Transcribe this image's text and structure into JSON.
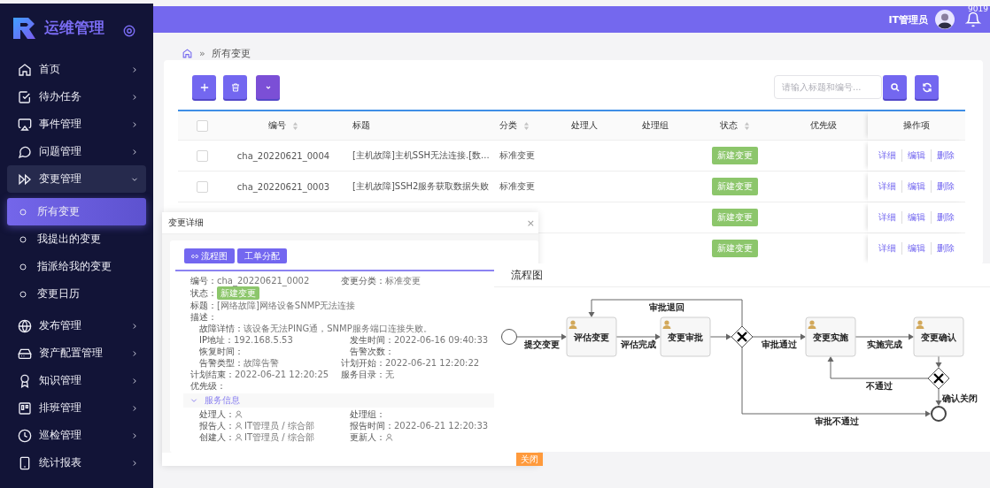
{
  "sidebar": {
    "brand": "运维管理",
    "items": [
      {
        "label": "首页",
        "expanded": false
      },
      {
        "label": "待办任务",
        "expanded": false
      },
      {
        "label": "事件管理",
        "expanded": false
      },
      {
        "label": "问题管理",
        "expanded": false
      },
      {
        "label": "变更管理",
        "expanded": true,
        "children": [
          {
            "label": "所有变更",
            "selected": true
          },
          {
            "label": "我提出的变更",
            "selected": false
          },
          {
            "label": "指派给我的变更",
            "selected": false
          },
          {
            "label": "变更日历",
            "selected": false
          }
        ]
      },
      {
        "label": "发布管理",
        "expanded": false
      },
      {
        "label": "资产配置管理",
        "expanded": false
      },
      {
        "label": "知识管理",
        "expanded": false
      },
      {
        "label": "排班管理",
        "expanded": false
      },
      {
        "label": "巡检管理",
        "expanded": false
      },
      {
        "label": "统计报表",
        "expanded": false
      }
    ]
  },
  "header": {
    "user": "IT管理员",
    "notification_count": "9019"
  },
  "breadcrumb": {
    "separator": "»",
    "current": "所有变更"
  },
  "toolbar": {
    "search": {
      "placeholder": "请输入标题和编号..."
    }
  },
  "table": {
    "columns": [
      {
        "kind": "checkbox",
        "checked": false
      },
      {
        "kind": "text",
        "label": "编号",
        "sortable": true
      },
      {
        "kind": "text",
        "label": "标题",
        "sortable": false
      },
      {
        "kind": "text",
        "label": "分类",
        "sortable": true
      },
      {
        "kind": "text",
        "label": "处理人",
        "sortable": false
      },
      {
        "kind": "text",
        "label": "处理组",
        "sortable": false
      },
      {
        "kind": "text",
        "label": "状态",
        "sortable": true
      },
      {
        "kind": "text",
        "label": "优先级",
        "sortable": false
      },
      {
        "kind": "text",
        "label": "操作项",
        "sortable": false
      }
    ],
    "rows": [
      {
        "checked": false,
        "number": "cha_20220621_0004",
        "title": "[主机故障]主机SSH无法连接.[数...",
        "category": "标准变更",
        "status": "新建变更",
        "actions": [
          "详细",
          "编辑",
          "删除"
        ]
      },
      {
        "checked": false,
        "number": "cha_20220621_0003",
        "title": "[主机故障]SSH2服务获取数据失败",
        "category": "标准变更",
        "status": "新建变更",
        "actions": [
          "详细",
          "编辑",
          "删除"
        ]
      },
      {
        "status": "新建变更",
        "actions": [
          "详细",
          "编辑",
          "删除"
        ]
      },
      {
        "status": "新建变更",
        "actions": [
          "详细",
          "编辑",
          "删除"
        ]
      }
    ]
  },
  "detail_dialog": {
    "title": "变更详细",
    "close": "×",
    "buttons": [
      {
        "label": "流程图",
        "icon": true
      },
      {
        "label": "工单分配",
        "icon": false
      }
    ],
    "fields": [
      {
        "kind": "half",
        "label": "编号：",
        "value": "cha_20220621_0002"
      },
      {
        "kind": "half",
        "label": "变更分类：",
        "value": "标准变更"
      },
      {
        "kind": "badge",
        "label": "状态：",
        "value": "新建变更"
      },
      {
        "kind": "wide",
        "label": "标题：",
        "value": "[网络故障]网络设备SNMP无法连接"
      },
      {
        "kind": "wide",
        "label": "描述："
      },
      {
        "kind": "detail_wide",
        "label": "故障详情：",
        "value": "该设备无法PING通，SNMP服务端口连接失败。"
      },
      {
        "kind": "detail",
        "label": "IP地址：",
        "value": "192.168.5.53"
      },
      {
        "kind": "detail",
        "label": "发生时间：",
        "value": "2022-06-16 09:40:33"
      },
      {
        "kind": "detail",
        "label": "恢复时间："
      },
      {
        "kind": "detail",
        "label": "告警次数："
      },
      {
        "kind": "detail",
        "label": "告警类型：",
        "value": "故障告警"
      },
      {
        "kind": "half",
        "label": "计划开始：",
        "value": "2022-06-21 12:20:22"
      },
      {
        "kind": "half",
        "label": "计划结束：",
        "value": "2022-06-21 12:20:25"
      },
      {
        "kind": "half",
        "label": "服务目录：",
        "value": "无"
      },
      {
        "kind": "half",
        "label": "优先级："
      }
    ],
    "section": {
      "title": "服务信息",
      "expanded": true,
      "fields": [
        {
          "label": "处理人：",
          "person": true
        },
        {
          "label": "处理组：",
          "person": false
        },
        {
          "label": "报告人：",
          "person": true,
          "value": "IT管理员 / 综合部"
        },
        {
          "label": "报告时间：",
          "person": false,
          "value": "2022-06-21 12:20:33"
        },
        {
          "label": "创建人：",
          "person": true,
          "value": "IT管理员 / 综合部"
        },
        {
          "label": "更新人：",
          "person": true
        }
      ]
    },
    "footer_button": "关闭"
  },
  "flow_diagram": {
    "title": "流程图",
    "nodes": [
      {
        "kind": "start"
      },
      {
        "kind": "task",
        "label": "评估变更"
      },
      {
        "kind": "task",
        "label": "变更审批"
      },
      {
        "kind": "gateway"
      },
      {
        "kind": "task",
        "label": "变更实施"
      },
      {
        "kind": "task",
        "label": "变更确认"
      },
      {
        "kind": "gateway"
      },
      {
        "kind": "end"
      }
    ],
    "edges": [
      {
        "kind": "arrow",
        "label": "提交变更"
      },
      {
        "kind": "arrow",
        "label": "评估完成"
      },
      {
        "kind": "arrow"
      },
      {
        "kind": "arrow",
        "label": "审批退回"
      },
      {
        "kind": "arrow",
        "label": "审批通过"
      },
      {
        "kind": "arrow",
        "label": "实施完成"
      },
      {
        "kind": "arrow"
      },
      {
        "kind": "arrow",
        "label": "不通过"
      },
      {
        "kind": "arrow",
        "label": "确认关闭"
      },
      {
        "kind": "arrow",
        "label": "审批不通过"
      }
    ]
  }
}
